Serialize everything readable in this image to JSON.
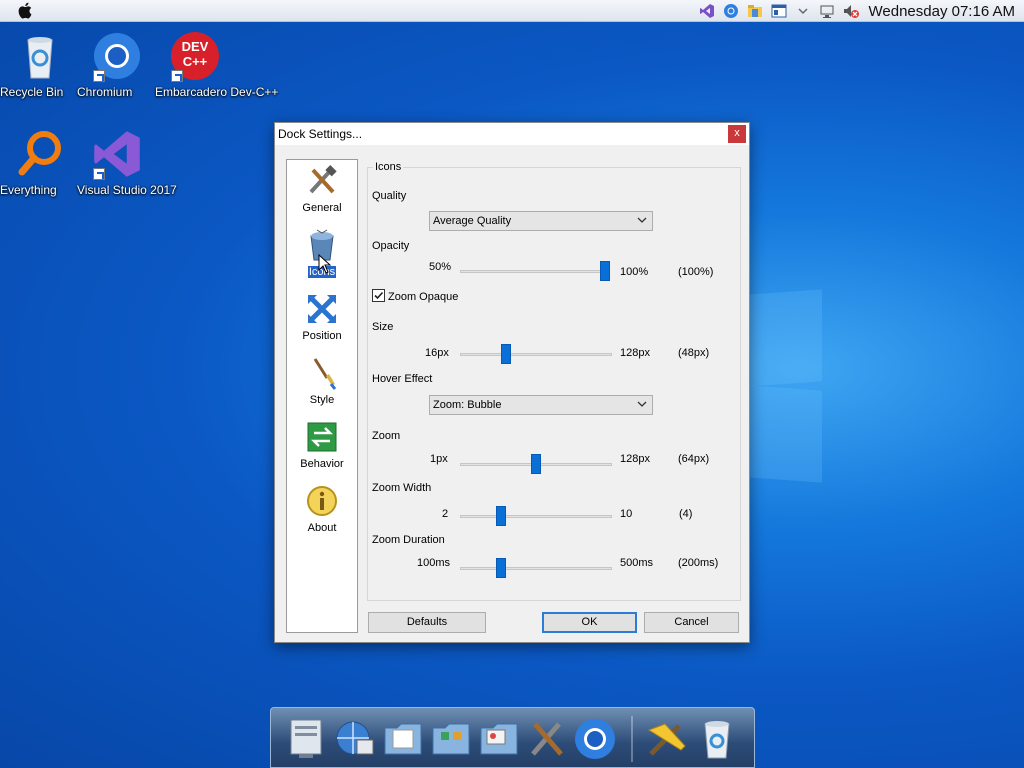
{
  "menubar": {
    "clock": "Wednesday 07:16 AM",
    "tray_icons": [
      "visual-studio-icon",
      "chromium-icon",
      "folder-icon",
      "window-icon",
      "chevron-down-icon",
      "network-icon",
      "volume-muted-icon"
    ]
  },
  "desktop": {
    "icons": [
      {
        "label": "Recycle Bin"
      },
      {
        "label": "Chromium"
      },
      {
        "label": "Embarcadero Dev-C++"
      },
      {
        "label": "Everything"
      },
      {
        "label": "Visual Studio 2017"
      }
    ],
    "devcpp_logo_text": "DEV C++"
  },
  "dialog": {
    "title": "Dock Settings...",
    "close": "x",
    "nav": [
      {
        "label": "General"
      },
      {
        "label": "Icons"
      },
      {
        "label": "Position"
      },
      {
        "label": "Style"
      },
      {
        "label": "Behavior"
      },
      {
        "label": "About"
      }
    ],
    "active_nav": "Icons",
    "group_title": "Icons",
    "quality": {
      "label": "Quality",
      "value": "Average Quality"
    },
    "opacity": {
      "label": "Opacity",
      "min": "50%",
      "max": "100%",
      "current": "(100%)",
      "value": 1.0
    },
    "zoom_opaque": {
      "label": "Zoom Opaque",
      "checked": true
    },
    "size": {
      "label": "Size",
      "min": "16px",
      "max": "128px",
      "current": "(48px)",
      "value": 0.29
    },
    "hover_effect": {
      "label": "Hover Effect",
      "value": "Zoom: Bubble"
    },
    "zoom": {
      "label": "Zoom",
      "min": "1px",
      "max": "128px",
      "current": "(64px)",
      "value": 0.5
    },
    "zoom_width": {
      "label": "Zoom Width",
      "min": "2",
      "max": "10",
      "current": "(4)",
      "value": 0.25
    },
    "zoom_duration": {
      "label": "Zoom Duration",
      "min": "100ms",
      "max": "500ms",
      "current": "(200ms)",
      "value": 0.25
    },
    "buttons": {
      "defaults": "Defaults",
      "ok": "OK",
      "cancel": "Cancel"
    }
  },
  "dock": {
    "items": [
      "system-preferences-icon",
      "network-globe-icon",
      "documents-folder-icon",
      "apps-folder-icon",
      "pictures-folder-icon",
      "dock-settings-icon",
      "chromium-icon",
      "tools-icon",
      "recycle-bin-icon"
    ]
  }
}
